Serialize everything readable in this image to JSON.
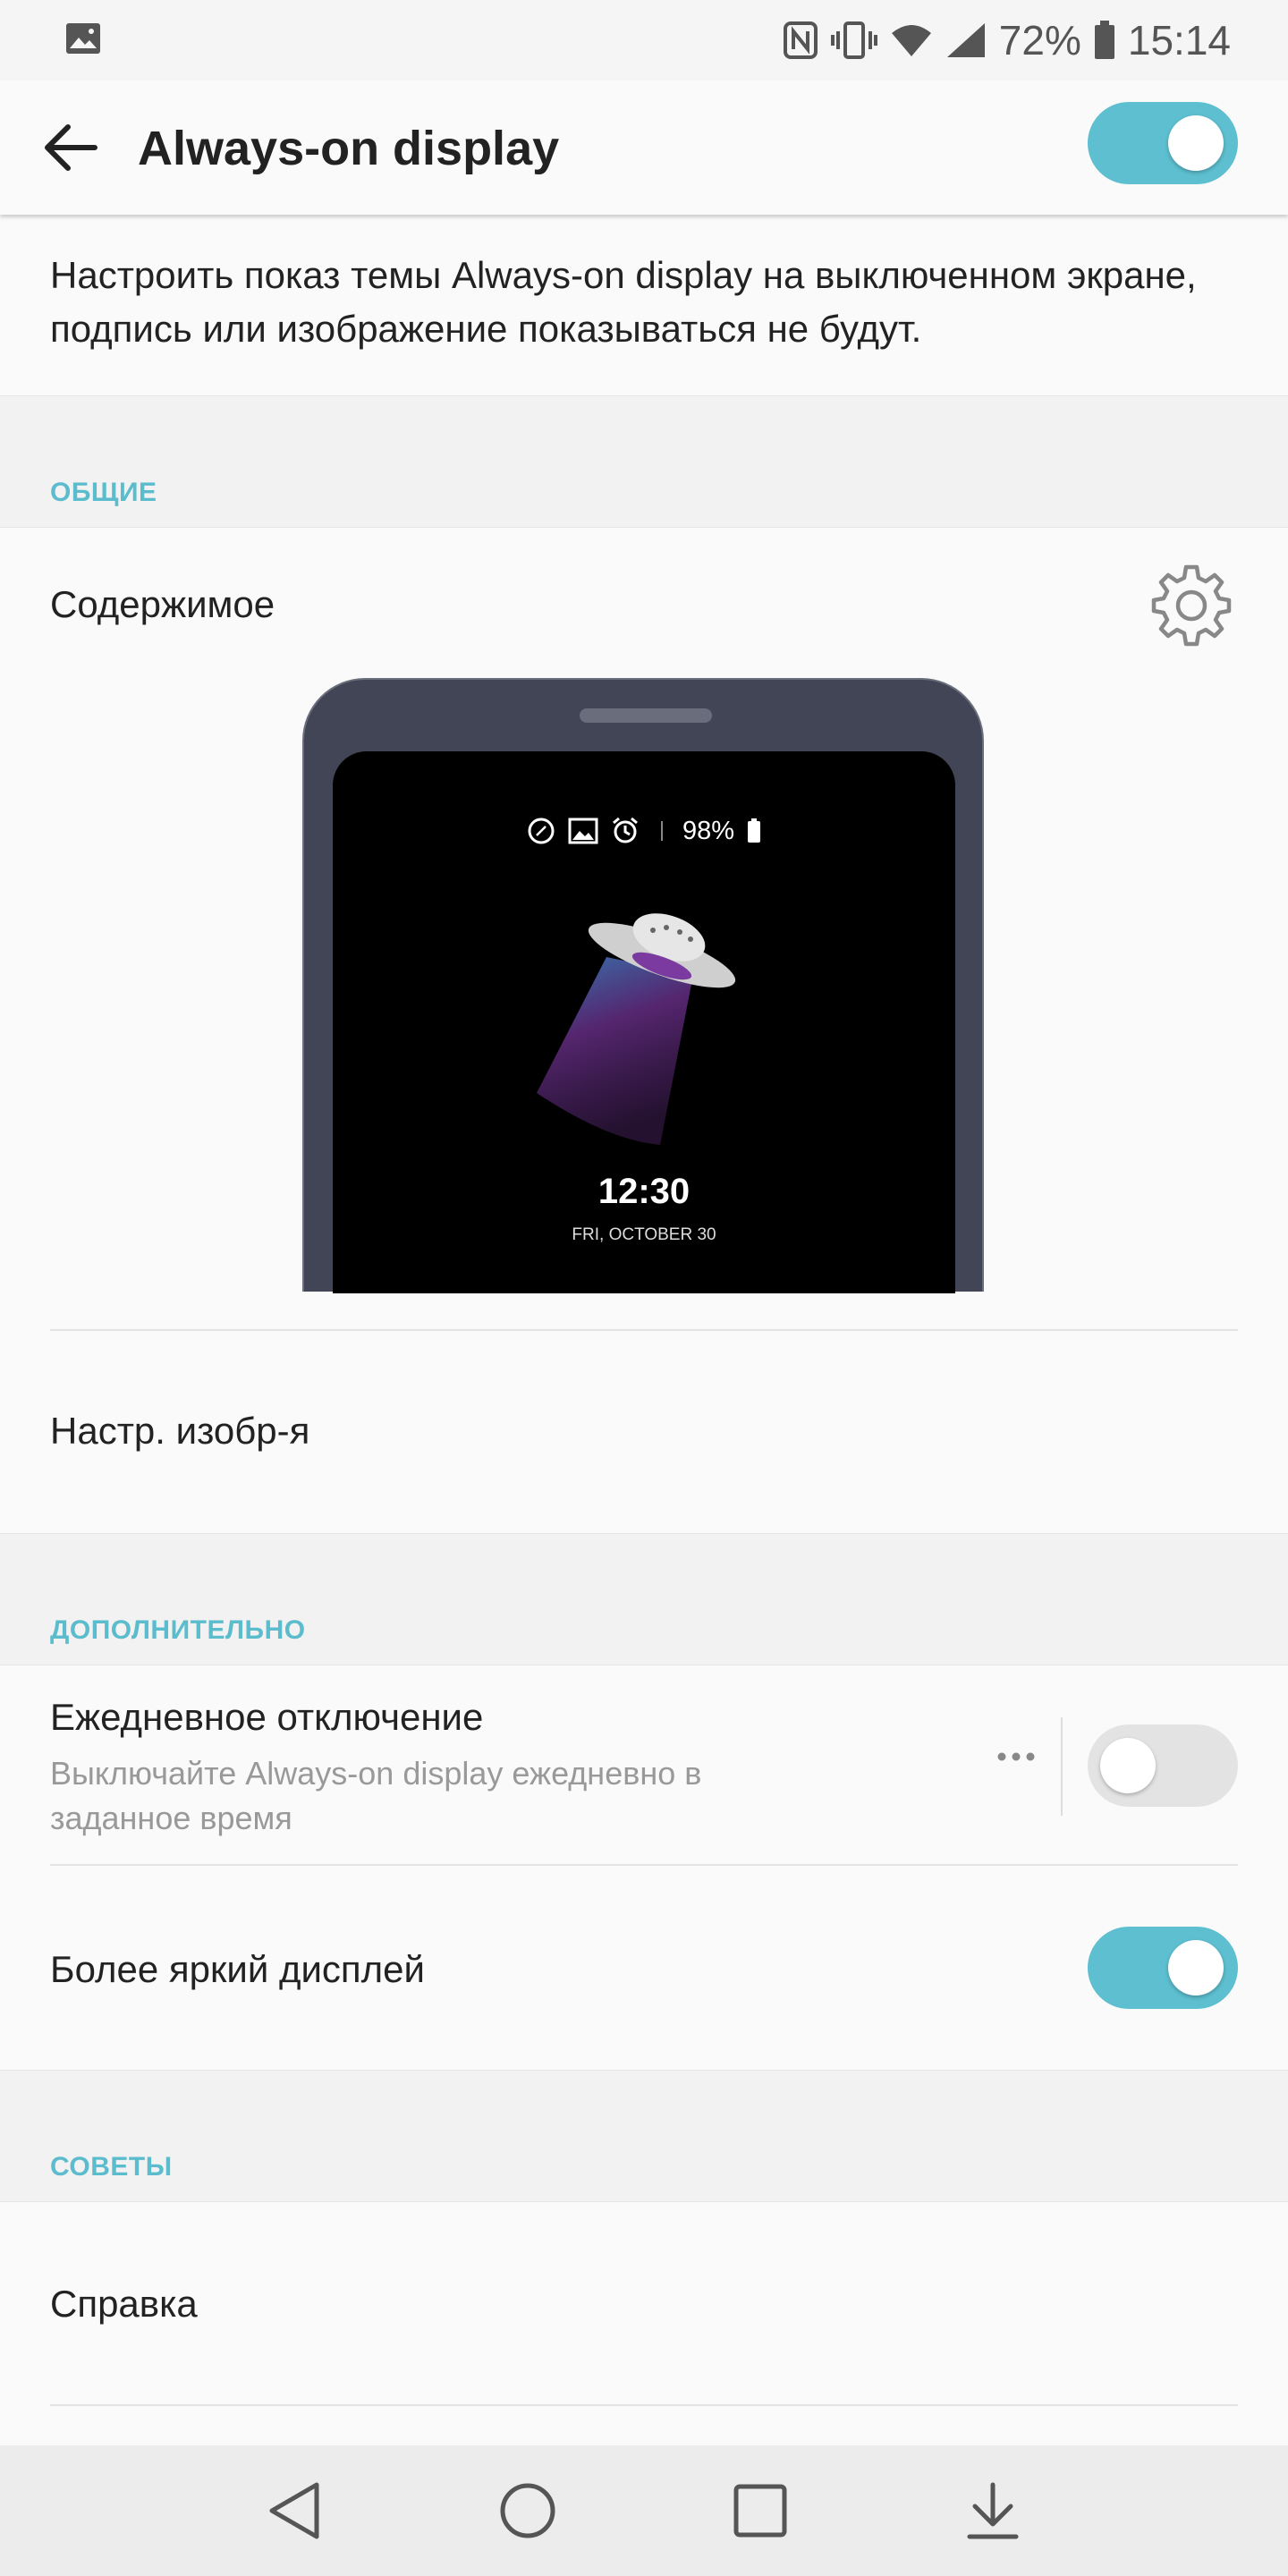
{
  "status_bar": {
    "battery_percent": "72%",
    "time": "15:14",
    "icons": [
      "image-icon",
      "nfc-icon",
      "vibrate-icon",
      "wifi-icon",
      "signal-icon",
      "battery-icon"
    ]
  },
  "app_bar": {
    "title": "Always-on display",
    "master_toggle_on": true
  },
  "description": "Настроить показ темы Always-on display на выключенном экране, подпись или изображение показываться не будут.",
  "sections": {
    "general": {
      "header": "ОБЩИЕ",
      "content_label": "Содержимое",
      "image_settings_label": "Настр. изобр-я",
      "preview": {
        "battery": "98%",
        "time": "12:30",
        "date": "FRI, OCTOBER 30"
      }
    },
    "additional": {
      "header": "ДОПОЛНИТЕЛЬНО",
      "daily_off": {
        "title": "Ежедневное отключение",
        "subtitle": "Выключайте Always-on display ежедневно в заданное время",
        "enabled": false
      },
      "brighter_display": {
        "title": "Более яркий дисплей",
        "enabled": true
      }
    },
    "tips": {
      "header": "СОВЕТЫ",
      "help_label": "Справка"
    }
  },
  "colors": {
    "accent": "#5bbccd",
    "toggle_on": "#5dbfcf",
    "phone_frame": "#424556"
  },
  "nav_bar": {
    "buttons": [
      "back-icon",
      "home-icon",
      "recents-icon",
      "notification-drawer-icon"
    ]
  }
}
